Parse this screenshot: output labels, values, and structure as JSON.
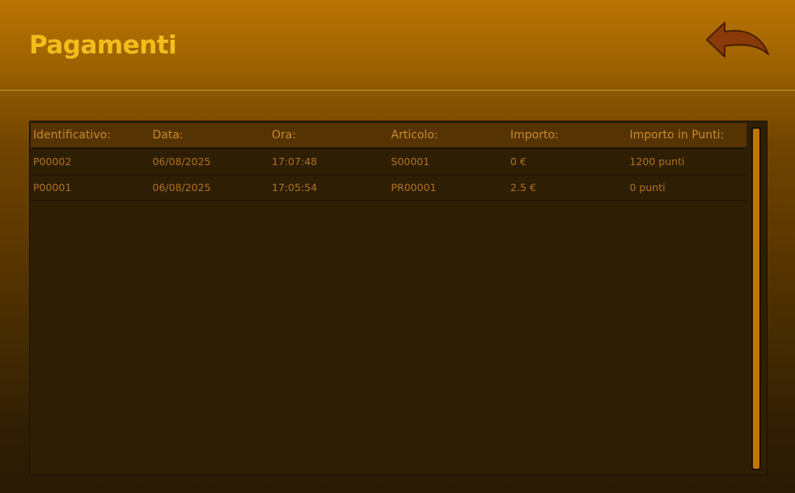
{
  "header": {
    "title": "Pagamenti",
    "back_icon": "back-arrow-icon"
  },
  "table": {
    "columns": [
      "Identificativo:",
      "Data:",
      "Ora:",
      "Articolo:",
      "Importo:",
      "Importo in Punti:"
    ],
    "rows": [
      [
        "P00002",
        "06/08/2025",
        "17:07:48",
        "S00001",
        "0 €",
        "1200 punti"
      ],
      [
        "P00001",
        "06/08/2025",
        "17:05:54",
        "PR00001",
        "2.5 €",
        "0 punti"
      ]
    ]
  },
  "colors": {
    "title": "#f3bd1c",
    "accent": "#c17604",
    "back_arrow": "#8a3a08"
  }
}
